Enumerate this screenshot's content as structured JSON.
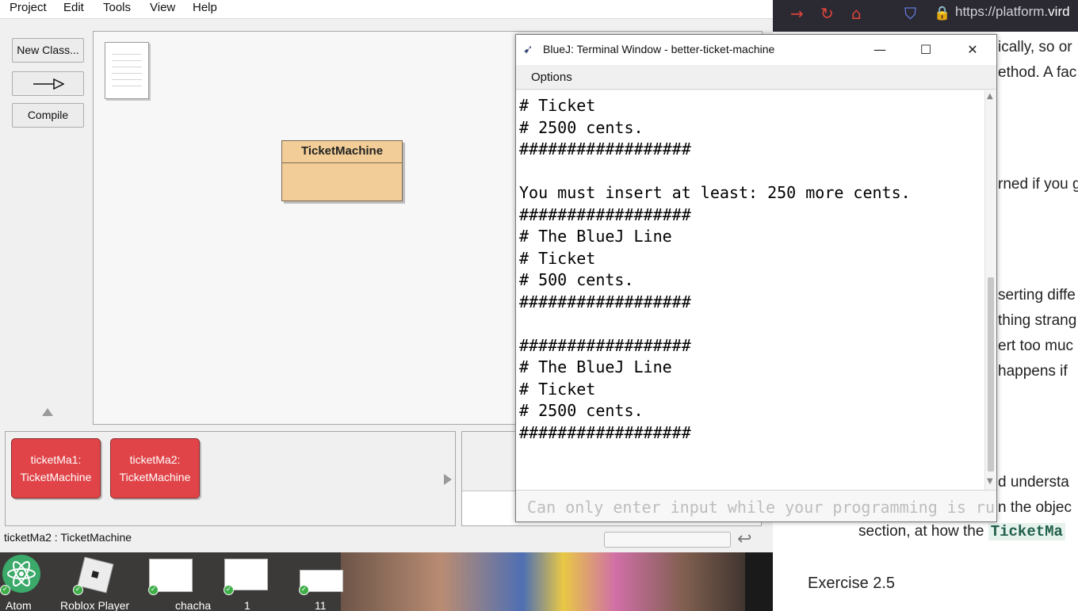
{
  "menubar": {
    "items": [
      "Project",
      "Edit",
      "Tools",
      "View",
      "Help"
    ]
  },
  "sidebar": {
    "new_class": "New Class...",
    "arrow_label": "→",
    "compile": "Compile"
  },
  "diagram": {
    "class_name": "TicketMachine"
  },
  "object_bench": {
    "objects": [
      {
        "line1": "ticketMa1:",
        "line2": "TicketMachine"
      },
      {
        "line1": "ticketMa2:",
        "line2": "TicketMachine"
      }
    ]
  },
  "status": {
    "text": "ticketMa2 : TicketMachine"
  },
  "terminal": {
    "title": "BlueJ: Terminal Window - better-ticket-machine",
    "menu_options": "Options",
    "lines": [
      "# Ticket",
      "# 2500 cents.",
      "##################",
      "",
      "You must insert at least: 250 more cents.",
      "##################",
      "# The BlueJ Line",
      "# Ticket",
      "# 500 cents.",
      "##################",
      "",
      "##################",
      "# The BlueJ Line",
      "# Ticket",
      "# 2500 cents.",
      "##################"
    ],
    "input_placeholder": "Can only enter input while your programming is ru"
  },
  "browser": {
    "url_prefix": "https://platform.",
    "url_bold": "vird",
    "page_lines": [
      "ically, so or",
      "ethod. A fac",
      "rned if you g",
      "serting diffe",
      "thing strang",
      "ert too muc",
      "happens if",
      "d understa",
      "n the objec"
    ],
    "section_text": "section, at how the",
    "code_chip": "TicketMa",
    "exercise": "Exercise 2.5"
  },
  "taskbar": {
    "apps": [
      {
        "label": "Atom",
        "icon": "atom-icon"
      },
      {
        "label": "Roblox Player",
        "icon": "roblox-icon"
      },
      {
        "label": "chacha",
        "icon": "document-thumb-icon"
      },
      {
        "label": "1",
        "icon": "document-thumb-icon"
      },
      {
        "label": "11",
        "icon": "document-thumb-icon"
      }
    ]
  },
  "colors": {
    "class_fill": "#f2cd98",
    "object_fill": "#e04448",
    "browser_toolbar": "#2b2a33",
    "taskbar_check": "#3fae49"
  }
}
